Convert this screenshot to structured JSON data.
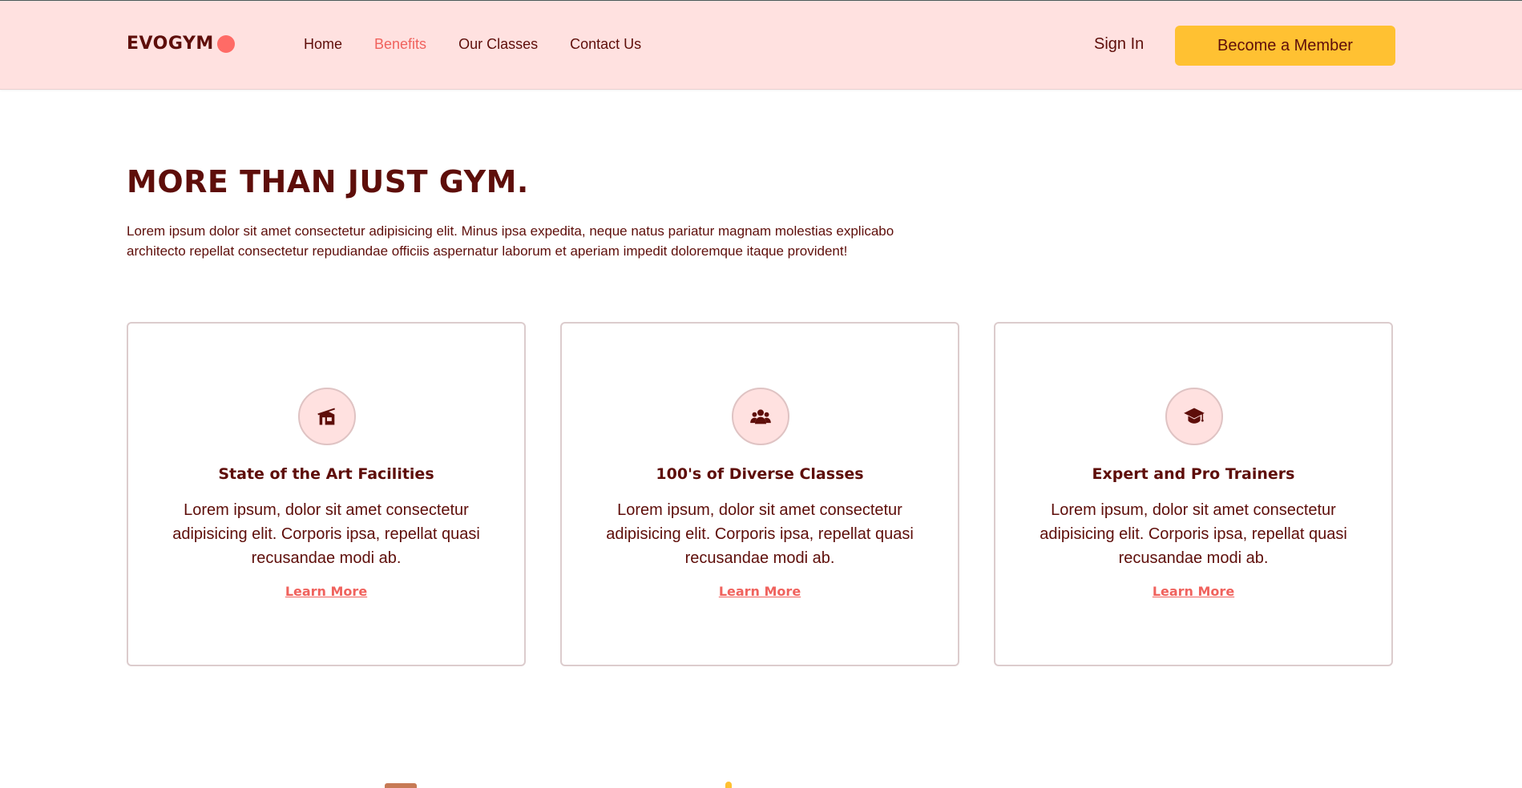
{
  "header": {
    "logo_text": "EVOGYM",
    "nav": [
      {
        "label": "Home",
        "active": false
      },
      {
        "label": "Benefits",
        "active": true
      },
      {
        "label": "Our Classes",
        "active": false
      },
      {
        "label": "Contact Us",
        "active": false
      }
    ],
    "sign_in_label": "Sign In",
    "cta_label": "Become a Member"
  },
  "main": {
    "title": "MORE THAN JUST GYM.",
    "intro": "Lorem ipsum dolor sit amet consectetur adipisicing elit. Minus ipsa expedita, neque natus pariatur magnam molestias explicabo architecto repellat consectetur repudiandae officiis aspernatur laborum et aperiam impedit doloremque itaque provident!",
    "cards": [
      {
        "icon": "home-modern-icon",
        "title": "State of the Art Facilities",
        "text": "Lorem ipsum, dolor sit amet consectetur adipisicing elit. Corporis ipsa, repellat quasi recusandae modi ab.",
        "link": "Learn More"
      },
      {
        "icon": "user-group-icon",
        "title": "100's of Diverse Classes",
        "text": "Lorem ipsum, dolor sit amet consectetur adipisicing elit. Corporis ipsa, repellat quasi recusandae modi ab.",
        "link": "Learn More"
      },
      {
        "icon": "academic-cap-icon",
        "title": "Expert and Pro Trainers",
        "text": "Lorem ipsum, dolor sit amet consectetur adipisicing elit. Corporis ipsa, repellat quasi recusandae modi ab.",
        "link": "Learn More"
      }
    ]
  },
  "colors": {
    "header_bg": "#ffe1e0",
    "primary_text": "#5e0e0a",
    "accent": "#f0625d",
    "cta": "#ffc132"
  }
}
